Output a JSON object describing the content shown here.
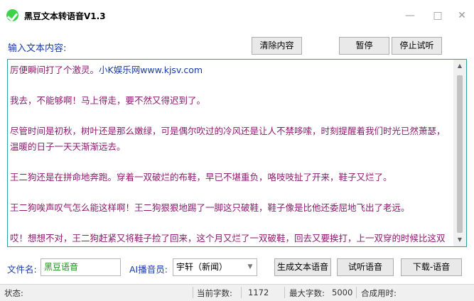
{
  "window": {
    "title": "黑豆文本转语音V1.3",
    "minimize_glyph": "—",
    "maximize_glyph": "□",
    "close_glyph": "✕"
  },
  "toolbar": {
    "input_label": "输入文本内容:",
    "clear_label": "清除内容",
    "pause_label": "暂停",
    "stop_preview_label": "停止试听"
  },
  "text": {
    "lines": [
      {
        "text": "厉便瞬间打了个激灵。",
        "link": "小K娱乐网www.kjsv.com"
      },
      {
        "text": ""
      },
      {
        "text": "我去，不能够啊！马上得走，要不然又得迟到了。"
      },
      {
        "text": ""
      },
      {
        "text": "尽管时间是初秋，树叶还是那么嫩绿，可是偶尔吹过的冷风还是让人不禁哆嗦，时刻提醒着我们时光已然萧瑟，温暖的日子一天天渐渐远去。"
      },
      {
        "text": ""
      },
      {
        "text": "王二狗还是在拼命地奔跑。穿着一双破烂的布鞋，早已不堪重负，咯吱吱扯了开来，鞋子又烂了。"
      },
      {
        "text": ""
      },
      {
        "text": "王二狗唉声叹气怎么能这样啊！王二狗狠狠地踢了一脚这只破鞋，鞋子像是比他还委屈地飞出了老远。"
      },
      {
        "text": ""
      },
      {
        "text": "哎！想想不对，王二狗赶紧又将鞋子捡了回来，这个月又烂了一双破鞋，回去又要挨打，上一双穿的时候比这双还略微好点，可是任然逃不过挣扎半个月的命运。"
      }
    ]
  },
  "bottom": {
    "filename_label": "文件名:",
    "filename_value": "黑豆语音",
    "announcer_label": "AI播音员:",
    "announcer_value": "宇轩（新闻）",
    "generate_label": "生成文本语音",
    "preview_label": "试听语音",
    "download_label": "下载-语音"
  },
  "status": {
    "status_label": "状态:",
    "status_value": "",
    "current_chars_label": "当前字数:",
    "current_chars_value": "1172",
    "max_chars_label": "最大字数:",
    "max_chars_value": "5000",
    "synth_time_label": "合成用时:",
    "synth_time_value": ""
  },
  "icons": {
    "app": "check-circle-icon",
    "scroll_up": "▲",
    "scroll_down": "▼",
    "dropdown": "▼"
  },
  "colors": {
    "accent_text": "#1a3aa8",
    "content_text": "#8d1a6e",
    "textarea_border": "#2aa39f",
    "filename_value": "#228b22",
    "app_icon": "#3bd34a"
  }
}
